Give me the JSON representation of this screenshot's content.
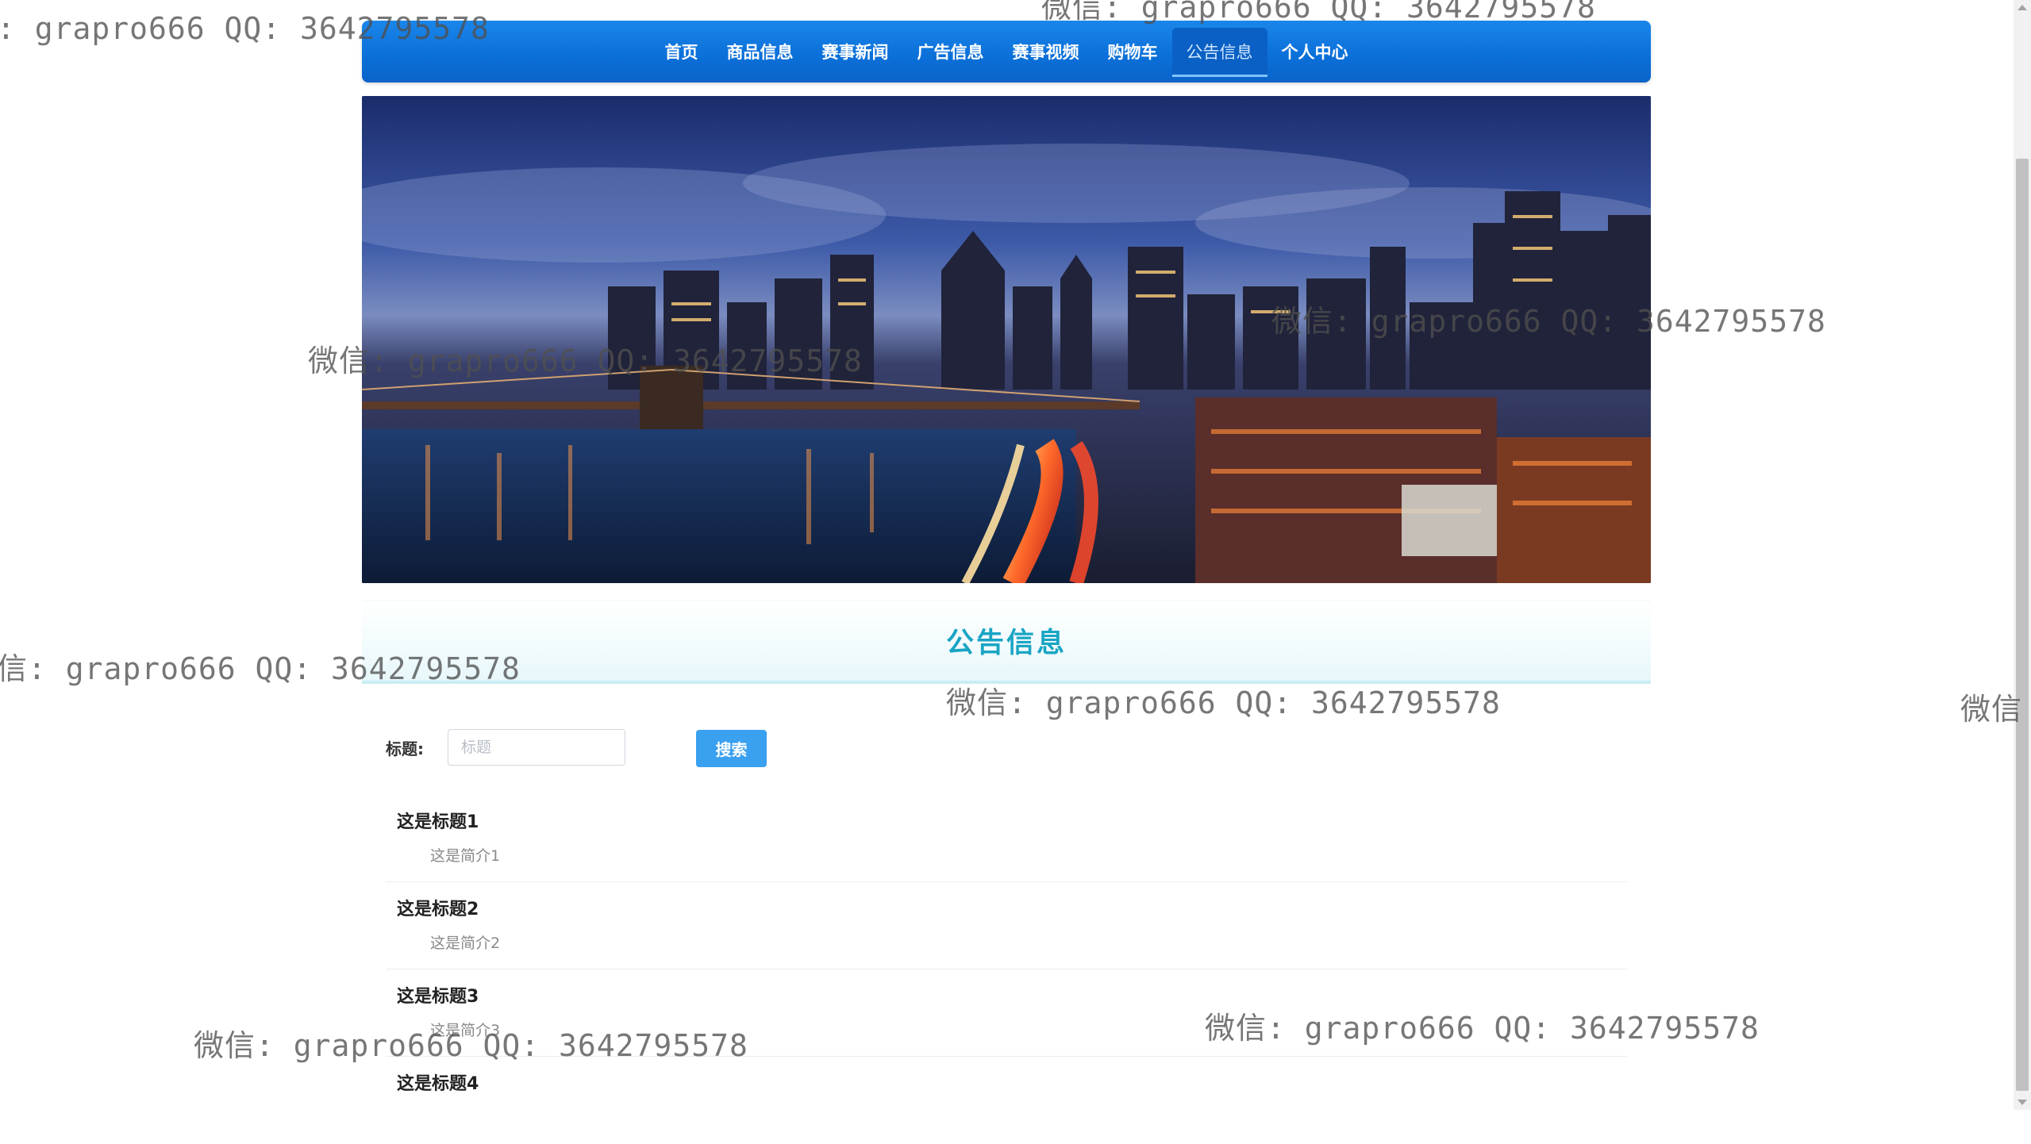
{
  "nav": {
    "items": [
      {
        "label": "首页"
      },
      {
        "label": "商品信息"
      },
      {
        "label": "赛事新闻"
      },
      {
        "label": "广告信息"
      },
      {
        "label": "赛事视频"
      },
      {
        "label": "购物车"
      },
      {
        "label": "公告信息",
        "active": true
      },
      {
        "label": "个人中心"
      }
    ]
  },
  "section": {
    "title": "公告信息"
  },
  "search": {
    "label": "标题:",
    "placeholder": "标题",
    "value": "",
    "button_label": "搜索"
  },
  "notices": [
    {
      "title": "这是标题1",
      "summary": "这是简介1"
    },
    {
      "title": "这是标题2",
      "summary": "这是简介2"
    },
    {
      "title": "这是标题3",
      "summary": "这是简介3"
    },
    {
      "title": "这是标题4",
      "summary": ""
    }
  ],
  "watermarks": {
    "w1": ": grapro666 QQ: 3642795578",
    "w2": "微信: grapro666 QQ: 3642795578",
    "w3": "微信: grapro666 QQ: 3642795578",
    "w4": "微信: grapro666 QQ: 3642795578",
    "w5": "信: grapro666 QQ: 3642795578",
    "w6": "微信: grapro666 QQ: 3642795578",
    "w7": "微信",
    "w8": "微信: grapro666 QQ: 3642795578",
    "w9": "微信: grapro666 QQ: 3642795578"
  },
  "colors": {
    "nav_bg": "#0b6fd8",
    "accent": "#1aa5c4",
    "button": "#3aa0f0"
  }
}
